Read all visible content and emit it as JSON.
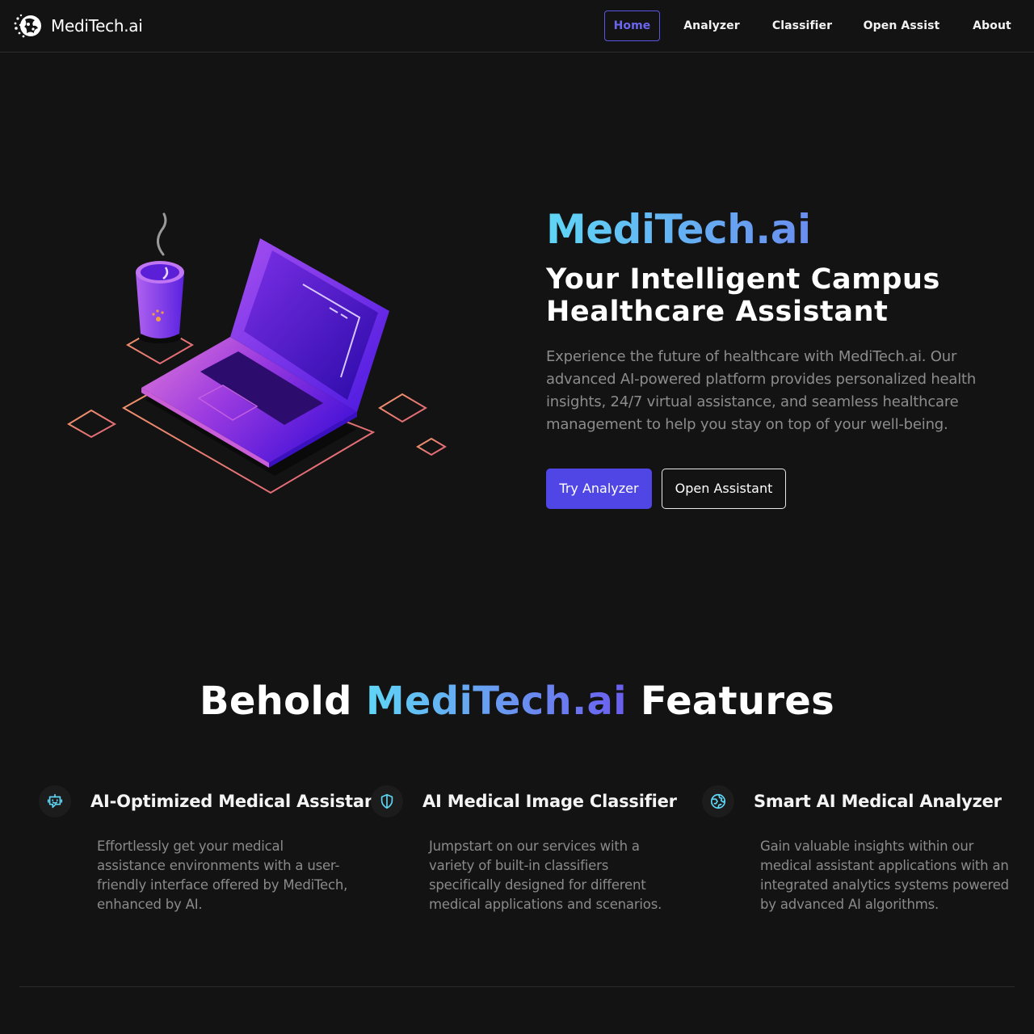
{
  "navbar": {
    "brand": "MediTech.ai",
    "links": [
      {
        "label": "Home",
        "active": true
      },
      {
        "label": "Analyzer",
        "active": false
      },
      {
        "label": "Classifier",
        "active": false
      },
      {
        "label": "Open Assist",
        "active": false
      },
      {
        "label": "About",
        "active": false
      }
    ]
  },
  "hero": {
    "title": "MediTech.ai",
    "subtitle": "Your Intelligent Campus Healthcare Assistant",
    "description": "Experience the future of healthcare with MediTech.ai. Our advanced AI-powered platform provides personalized health insights, 24/7 virtual assistance, and seamless healthcare management to help you stay on top of your well-being.",
    "primary_button": "Try Analyzer",
    "secondary_button": "Open Assistant"
  },
  "features": {
    "heading_prefix": "Behold ",
    "heading_highlight": "MediTech.ai",
    "heading_suffix": " Features",
    "items": [
      {
        "icon": "robot-icon",
        "title": "AI-Optimized Medical Assistant",
        "description": "Effortlessly get your medical assistance environments with a user-friendly interface offered by MediTech, enhanced by AI."
      },
      {
        "icon": "shield-icon",
        "title": "AI Medical Image Classifier",
        "description": "Jumpstart on our services with a variety of built-in classifiers specifically designed for different medical applications and scenarios."
      },
      {
        "icon": "globe-icon",
        "title": "Smart AI Medical Analyzer",
        "description": "Gain valuable insights within our medical assistant applications with an integrated analytics systems powered by advanced AI algorithms."
      }
    ]
  },
  "colors": {
    "background": "#131313",
    "accent": "#4f46e5",
    "gradient_start": "#5fd6f6",
    "gradient_end": "#6a5df0",
    "muted_text": "#8c8c8c",
    "icon_cyan": "#5fd6f6"
  }
}
